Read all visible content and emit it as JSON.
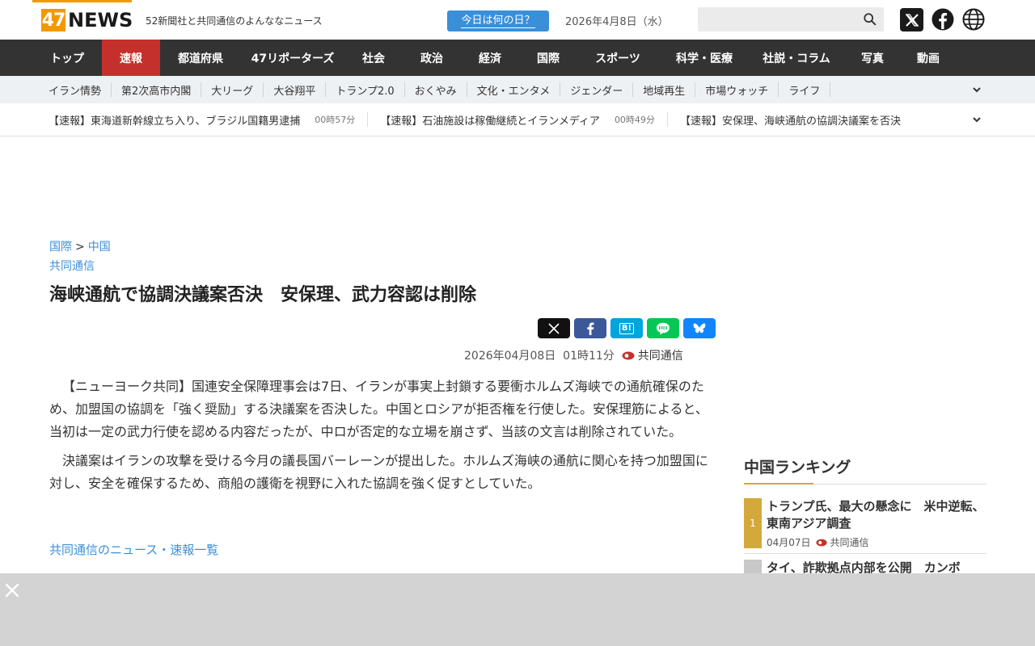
{
  "header": {
    "logo_number": "47",
    "logo_text": "NEWS",
    "tagline": "52新聞社と共同通信のよんななニュース",
    "today_button": "今日は何の日？",
    "date": "2026年4月8日（水）",
    "search_placeholder": ""
  },
  "mainnav": [
    {
      "label": "トップ",
      "width": 86
    },
    {
      "label": "速報",
      "width": 72,
      "active": true
    },
    {
      "label": "都道府県",
      "width": 100
    },
    {
      "label": "47リポーターズ",
      "width": 128
    },
    {
      "label": "社会",
      "width": 72
    },
    {
      "label": "政治",
      "width": 72
    },
    {
      "label": "経済",
      "width": 72
    },
    {
      "label": "国際",
      "width": 72
    },
    {
      "label": "スポーツ",
      "width": 100
    },
    {
      "label": "科学・医療",
      "width": 114
    },
    {
      "label": "社説・コラム",
      "width": 114
    },
    {
      "label": "写真",
      "width": 74
    },
    {
      "label": "動画",
      "width": 64
    }
  ],
  "subnav": [
    "イラン情勢",
    "第2次高市内閣",
    "大リーグ",
    "大谷翔平",
    "トランプ2.0",
    "おくやみ",
    "文化・エンタメ",
    "ジェンダー",
    "地域再生",
    "市場ウォッチ",
    "ライフ"
  ],
  "ticker": [
    {
      "title": "【速報】東海道新幹線立ち入り、ブラジル国籍男逮捕",
      "time": "00時57分"
    },
    {
      "title": "【速報】石油施設は稼働継続とイランメディア",
      "time": "00時49分"
    },
    {
      "title": "【速報】安保理、海峡通航の協調決議案を否決",
      "time": ""
    }
  ],
  "article": {
    "breadcrumb_1": "国際",
    "breadcrumb_sep": ">",
    "breadcrumb_2": "中国",
    "source_link": "共同通信",
    "headline": "海峡通航で協調決議案否決　安保理、武力容認は削除",
    "share_hatena": "B!",
    "pub_datetime": "2026年04月08日  01時11分",
    "pub_source": "共同通信",
    "paragraphs": [
      "【ニューヨーク共同】国連安全保障理事会は7日、イランが事実上封鎖する要衝ホルムズ海峡での通航確保のため、加盟国の協調を「強く奨励」する決議案を否決した。中国とロシアが拒否権を行使した。安保理筋によると、当初は一定の武力行使を認める内容だったが、中ロが否定的な立場を崩さず、当該の文言は削除されていた。",
      "決議案はイランの攻撃を受ける今月の議長国バーレーンが提出した。ホルムズ海峡の通航に関心を持つ加盟国に対し、安全を確保するため、商船の護衛を視野に入れた協調を強く促すとしていた。"
    ],
    "more_link": "共同通信のニュース・速報一覧"
  },
  "sidebar": {
    "ranking_title": "中国ランキング",
    "items": [
      {
        "rank": "1",
        "title": "トランプ氏、最大の懸念に　米中逆転、東南アジア調査",
        "date": "04月07日",
        "source": "共同通信"
      },
      {
        "rank": "",
        "title": "タイ、詐欺拠点内部を公開　カンボ",
        "date": "",
        "source": ""
      }
    ]
  },
  "colors": {
    "brand_orange": "#f39800",
    "nav_dark": "#333333",
    "nav_active": "#c4302b",
    "link_blue": "#3a8fd9",
    "rank_gold": "#d4a93c"
  }
}
